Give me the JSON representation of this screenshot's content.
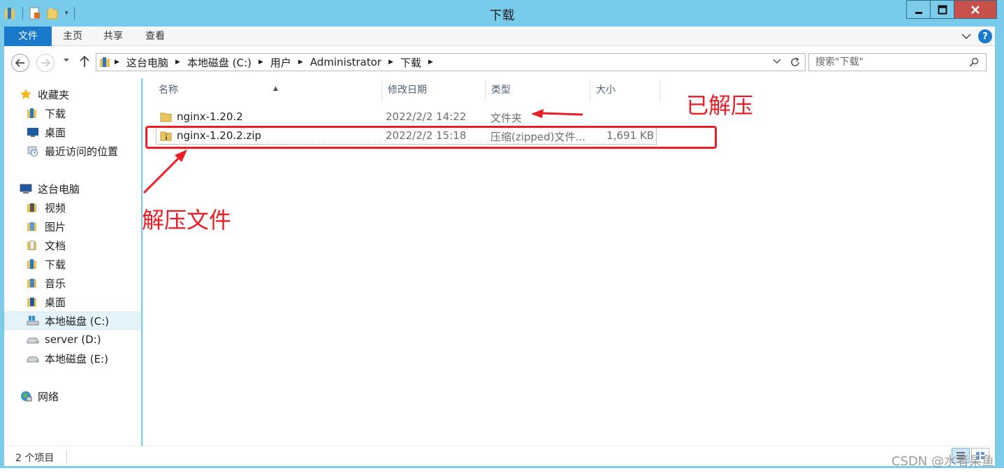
{
  "window": {
    "title": "下载"
  },
  "ribbon": {
    "tabs": [
      {
        "label": "文件"
      },
      {
        "label": "主页"
      },
      {
        "label": "共享"
      },
      {
        "label": "查看"
      }
    ]
  },
  "address": {
    "crumbs": [
      "这台电脑",
      "本地磁盘 (C:)",
      "用户",
      "Administrator",
      "下载"
    ]
  },
  "search": {
    "placeholder": "搜索\"下载\""
  },
  "sidebar": {
    "favorites": {
      "label": "收藏夹",
      "items": [
        {
          "label": "下载",
          "icon": "downloads-folder-icon"
        },
        {
          "label": "桌面",
          "icon": "desktop-icon"
        },
        {
          "label": "最近访问的位置",
          "icon": "recent-places-icon"
        }
      ]
    },
    "this_pc": {
      "label": "这台电脑",
      "items": [
        {
          "label": "视频",
          "icon": "videos-folder-icon"
        },
        {
          "label": "图片",
          "icon": "pictures-folder-icon"
        },
        {
          "label": "文档",
          "icon": "documents-folder-icon"
        },
        {
          "label": "下载",
          "icon": "downloads-folder-icon"
        },
        {
          "label": "音乐",
          "icon": "music-folder-icon"
        },
        {
          "label": "桌面",
          "icon": "desktop-folder-icon"
        },
        {
          "label": "本地磁盘 (C:)",
          "icon": "system-drive-icon",
          "selected": true
        },
        {
          "label": "server (D:)",
          "icon": "drive-icon"
        },
        {
          "label": "本地磁盘 (E:)",
          "icon": "drive-icon"
        }
      ]
    },
    "network": {
      "label": "网络"
    }
  },
  "columns": {
    "name": "名称",
    "date": "修改日期",
    "type": "类型",
    "size": "大小"
  },
  "files": [
    {
      "name": "nginx-1.20.2",
      "date": "2022/2/2 14:22",
      "type": "文件夹",
      "size": "",
      "icon": "folder-icon"
    },
    {
      "name": "nginx-1.20.2.zip",
      "date": "2022/2/2 15:18",
      "type": "压缩(zipped)文件...",
      "size": "1,691 KB",
      "icon": "zip-folder-icon"
    }
  ],
  "status": {
    "item_count": "2 个项目"
  },
  "annotations": {
    "extracted": "已解压",
    "extract_file": "解压文件",
    "color": "#ee1c24"
  },
  "watermark": "CSDN @水者杲鱼"
}
